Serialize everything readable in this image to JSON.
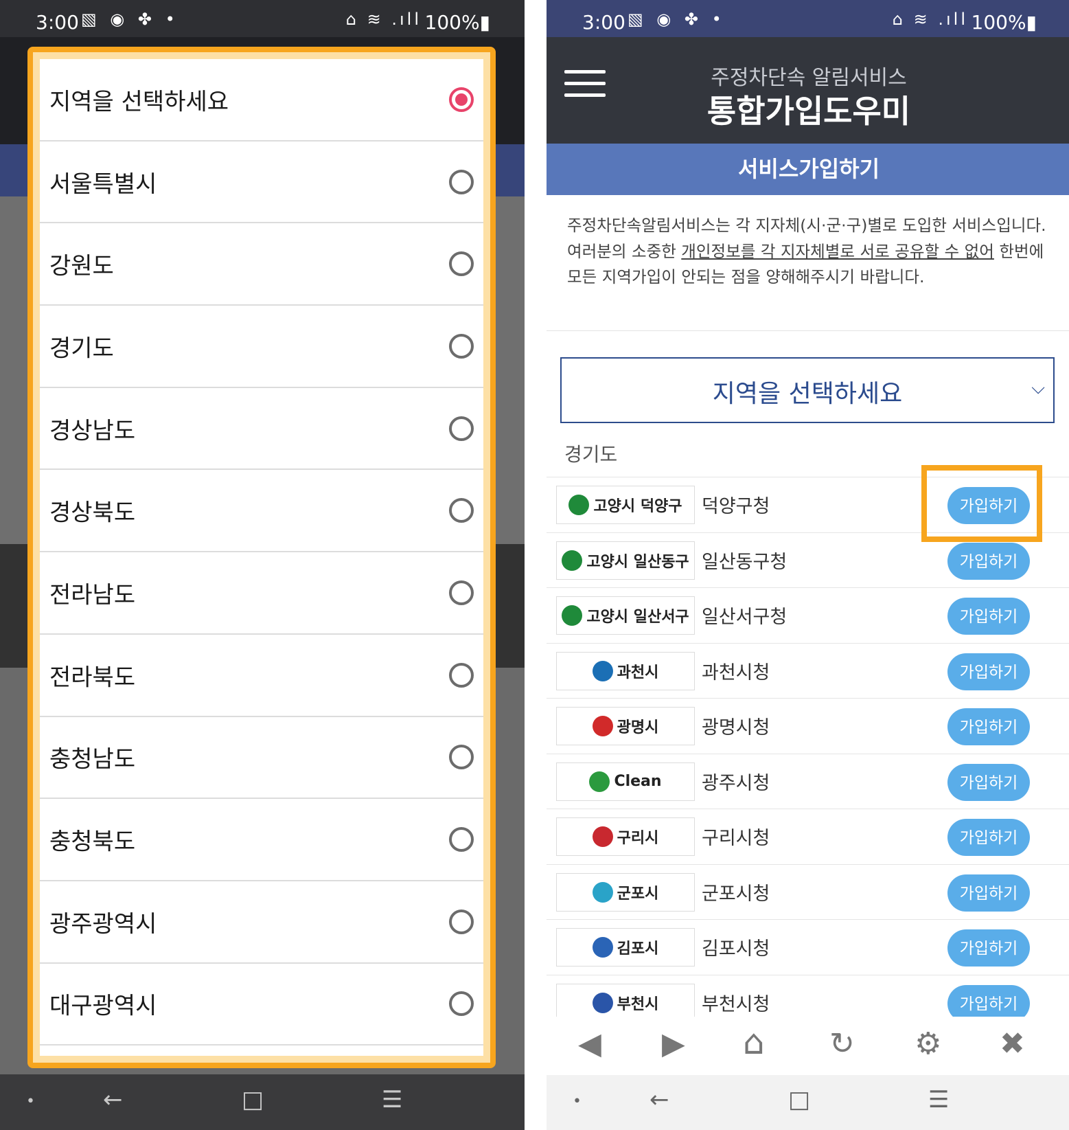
{
  "status_bar": {
    "time": "3:00",
    "notif_icons": "▧ ◉ ✤ •",
    "signal_icons": "⌂ ≋ .ıll",
    "battery": "100%▮"
  },
  "left": {
    "dialog": {
      "options": [
        {
          "label": "지역을 선택하세요",
          "checked": true
        },
        {
          "label": "서울특별시",
          "checked": false
        },
        {
          "label": "강원도",
          "checked": false
        },
        {
          "label": "경기도",
          "checked": false
        },
        {
          "label": "경상남도",
          "checked": false
        },
        {
          "label": "경상북도",
          "checked": false
        },
        {
          "label": "전라남도",
          "checked": false
        },
        {
          "label": "전라북도",
          "checked": false
        },
        {
          "label": "충청남도",
          "checked": false
        },
        {
          "label": "충청북도",
          "checked": false
        },
        {
          "label": "광주광역시",
          "checked": false
        },
        {
          "label": "대구광역시",
          "checked": false
        }
      ]
    }
  },
  "right": {
    "header": {
      "subtitle": "주정차단속 알림서비스",
      "title": "통합가입도우미"
    },
    "band": "서비스가입하기",
    "notice": {
      "line1": "주정차단속알림서비스는 각 지자체(시·군·구)별로 도입한 서비스입니다.",
      "line2_before": "여러분의 소중한 ",
      "line2_underlined": "개인정보를 각 지자체별로 서로 공유할 수 없어",
      "line2_after": " 한번에 모든 지역가입이 안되는 점을 양해해주시기 바랍니다."
    },
    "region_select": {
      "value": "지역을 선택하세요",
      "chevron": "⌵"
    },
    "group_label": "경기도",
    "rows": [
      {
        "logo": "고양시 덕양구",
        "name": "덕양구청",
        "button": "가입하기",
        "mark_color": "#1f8a3a"
      },
      {
        "logo": "고양시 일산동구",
        "name": "일산동구청",
        "button": "가입하기",
        "mark_color": "#1f8a3a"
      },
      {
        "logo": "고양시 일산서구",
        "name": "일산서구청",
        "button": "가입하기",
        "mark_color": "#1f8a3a"
      },
      {
        "logo": "과천시",
        "name": "과천시청",
        "button": "가입하기",
        "mark_color": "#1b6fb5"
      },
      {
        "logo": "광명시",
        "name": "광명시청",
        "button": "가입하기",
        "mark_color": "#d12a2a"
      },
      {
        "logo": "Clean",
        "name": "광주시청",
        "button": "가입하기",
        "mark_color": "#2b9a3e"
      },
      {
        "logo": "구리시",
        "name": "구리시청",
        "button": "가입하기",
        "mark_color": "#c8282f"
      },
      {
        "logo": "군포시",
        "name": "군포시청",
        "button": "가입하기",
        "mark_color": "#2aa3c8"
      },
      {
        "logo": "김포시",
        "name": "김포시청",
        "button": "가입하기",
        "mark_color": "#2a64b6"
      },
      {
        "logo": "부천시",
        "name": "부천시청",
        "button": "가입하기",
        "mark_color": "#2a55a8"
      }
    ],
    "toolbar": {
      "back": "◀",
      "forward": "▶",
      "home": "⌂",
      "refresh": "↻",
      "settings": "⚙",
      "close": "✖"
    }
  },
  "nav_bar": {
    "dot": "•",
    "back": "←",
    "home": "□",
    "recents": "☰"
  },
  "colors": {
    "accent_highlight": "#f7a51e",
    "radio_checked": "#e8436a",
    "join_button": "#5aade9",
    "band": "#5877ba"
  }
}
